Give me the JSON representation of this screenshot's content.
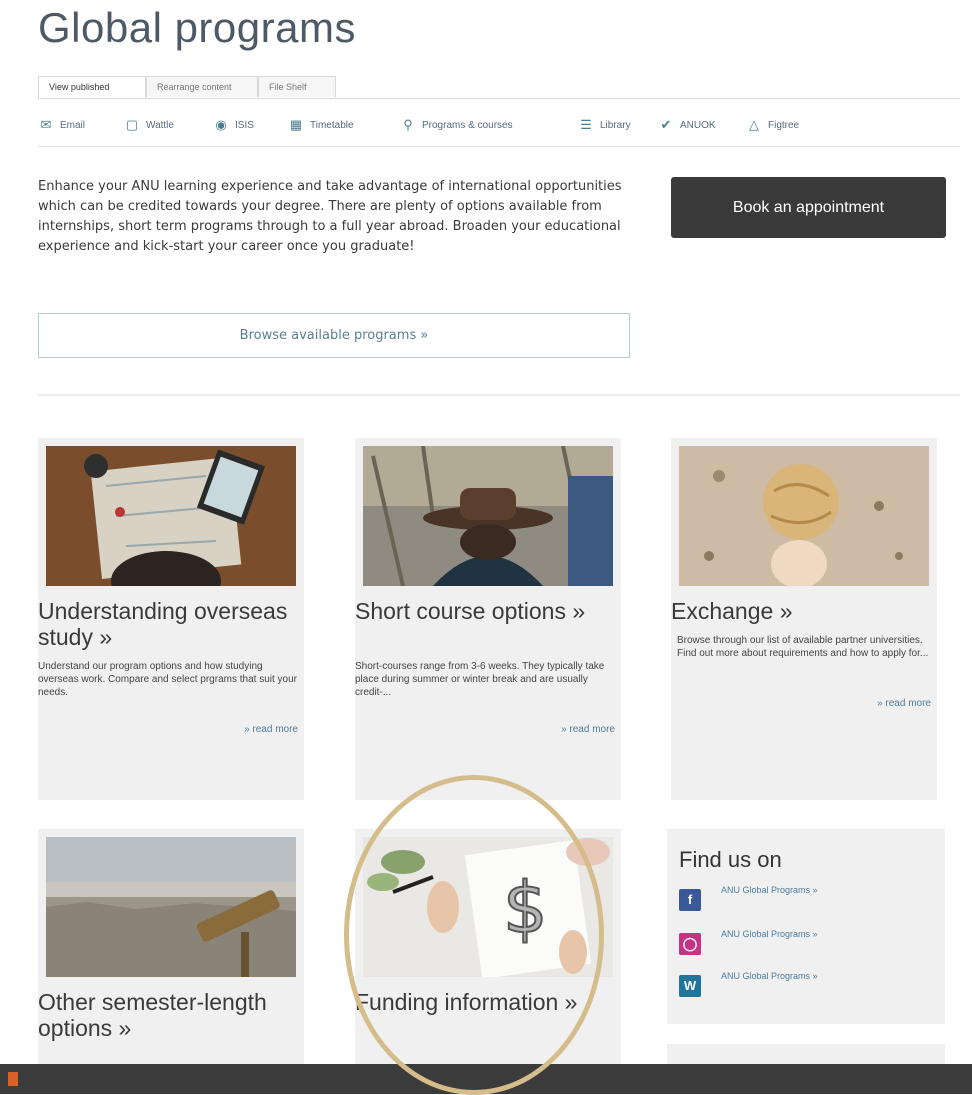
{
  "page_title": "Global programs",
  "tabs": [
    {
      "label": "View published"
    },
    {
      "label": "Rearrange content"
    },
    {
      "label": "File Shelf"
    }
  ],
  "shortcuts": [
    {
      "label": "Email",
      "icon": "email-icon"
    },
    {
      "label": "Wattle",
      "icon": "wattle-icon"
    },
    {
      "label": "ISIS",
      "icon": "isis-icon"
    },
    {
      "label": "Timetable",
      "icon": "timetable-icon"
    },
    {
      "label": "Programs & courses",
      "icon": "programs-courses-icon"
    },
    {
      "label": "Library",
      "icon": "library-icon"
    },
    {
      "label": "ANUOK",
      "icon": "anuok-icon"
    },
    {
      "label": "Figtree",
      "icon": "figtree-icon"
    }
  ],
  "intro": "Enhance your ANU learning experience and take advantage of international opportunities which can be credited towards your degree. There are plenty of options available from internships, short term programs through to a full year abroad. Broaden your educational experience and kick-start your career once you graduate!",
  "book_button": "Book an appointment",
  "browse_button": "Browse available programs »",
  "cards": [
    {
      "heading": "Understanding overseas study »",
      "desc": "Understand our program options and how studying overseas work. Compare and select prgrams that suit your needs.",
      "more": "» read more"
    },
    {
      "heading": "Short course options »",
      "desc": "Short-courses range from 3-6 weeks. They typically take place during summer or winter break and are usually credit-...",
      "more": "» read more"
    },
    {
      "heading": "Exchange »",
      "desc": "Browse through our list of available partner universities. Find out more about requirements and how to apply for...",
      "more": "» read more"
    },
    {
      "heading": "Other semester-length options »"
    },
    {
      "heading": "Funding information »"
    }
  ],
  "social": {
    "heading": "Find us on",
    "items": [
      {
        "label": "ANU Global Programs »",
        "icon": "facebook-icon"
      },
      {
        "label": "ANU Global Programs »",
        "icon": "instagram-icon"
      },
      {
        "label": "ANU Global Programs »",
        "icon": "wordpress-icon"
      }
    ]
  },
  "colors": {
    "highlight_ring": "#d4bd8a",
    "link": "#4f7c9c",
    "button_dark": "#3a3a3a"
  }
}
